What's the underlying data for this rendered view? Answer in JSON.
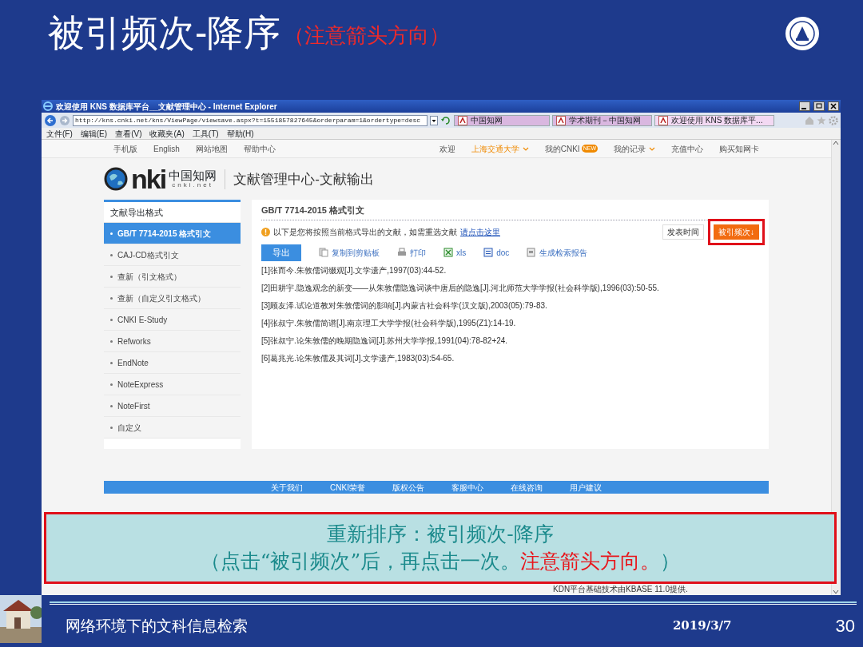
{
  "slide": {
    "title": "被引频次-降序",
    "title_note": "（注意箭头方向）"
  },
  "browser": {
    "title": "欢迎使用 KNS 数据库平台__文献管理中心 - Internet Explorer",
    "address": "http://kns.cnki.net/kns/ViewPage/viewsave.aspx?t=1551857827645&orderparam=1&ordertype=desc",
    "tabs": [
      {
        "label": "中国知网",
        "selected": false
      },
      {
        "label": "学术期刊－中国知网",
        "selected": false
      },
      {
        "label": "欢迎使用 KNS 数据库平...",
        "selected": true
      }
    ],
    "menu": [
      "文件(F)",
      "编辑(E)",
      "查看(V)",
      "收藏夹(A)",
      "工具(T)",
      "帮助(H)"
    ]
  },
  "site": {
    "top_links": [
      "手机版",
      "English",
      "网站地图",
      "帮助中心"
    ],
    "user_links": [
      {
        "label": "欢迎",
        "kind": "plain"
      },
      {
        "label": "上海交通大学",
        "kind": "highlight"
      },
      {
        "label": "我的CNKI",
        "kind": "badge",
        "badge": "NEW"
      },
      {
        "label": "我的记录",
        "kind": "dropdown"
      },
      {
        "label": "充值中心",
        "kind": "plain"
      },
      {
        "label": "购买知网卡",
        "kind": "plain"
      }
    ],
    "logo": {
      "mark": "nki",
      "name": "中国知网",
      "domain": "cnki.net"
    },
    "page_title": "文献管理中心-文献输出",
    "sidebar": {
      "heading": "文献导出格式",
      "items": [
        {
          "label": "GB/T 7714-2015 格式引文",
          "selected": true
        },
        {
          "label": "CAJ-CD格式引文",
          "selected": false
        },
        {
          "label": "查新（引文格式）",
          "selected": false
        },
        {
          "label": "查新（自定义引文格式）",
          "selected": false
        },
        {
          "label": "CNKI E-Study",
          "selected": false
        },
        {
          "label": "Refworks",
          "selected": false
        },
        {
          "label": "EndNote",
          "selected": false
        },
        {
          "label": "NoteExpress",
          "selected": false
        },
        {
          "label": "NoteFirst",
          "selected": false
        },
        {
          "label": "自定义",
          "selected": false
        }
      ]
    },
    "content": {
      "heading": "GB/T 7714-2015 格式引文",
      "notice": "以下是您将按照当前格式导出的文献，如需重选文献",
      "notice_link": "请点击这里",
      "sort": {
        "highlighted": true,
        "buttons": [
          {
            "label": "发表时间",
            "selected": false
          },
          {
            "label": "被引频次↓",
            "selected": true
          }
        ]
      },
      "export_button": "导出",
      "tools": [
        {
          "label": "复制到剪贴板",
          "kind": "copy"
        },
        {
          "label": "打印",
          "kind": "print"
        },
        {
          "label": "xls",
          "kind": "xls"
        },
        {
          "label": "doc",
          "kind": "doc"
        },
        {
          "label": "生成检索报告",
          "kind": "report"
        }
      ],
      "references": [
        "[1]张而今.朱敦儒词缀观[J].文学遗产,1997(03):44-52.",
        "[2]田耕宇.隐逸观念的新变——从朱敦儒隐逸词谈中唐后的隐逸[J].河北师范大学学报(社会科学版),1996(03):50-55.",
        "[3]顾友泽.试论道教对朱敦儒词的影响[J].内蒙古社会科学(汉文版),2003(05):79-83.",
        "[4]张叔宁.朱敦儒简谱[J].南京理工大学学报(社会科学版),1995(Z1):14-19.",
        "[5]张叔宁.论朱敦儒的晚期隐逸词[J].苏州大学学报,1991(04):78-82+24.",
        "[6]葛兆光.论朱敦儒及其词[J].文学遗产,1983(03):54-65."
      ]
    },
    "footer_links": [
      "关于我们",
      "CNKI荣誉",
      "版权公告",
      "客服中心",
      "在线咨询",
      "用户建议"
    ],
    "credit": "KDN平台基础技术由KBASE 11.0提供."
  },
  "callout": {
    "line1": "重新排序：被引频次-降序",
    "line2": [
      {
        "text": "（点击“被引频次”后，再点击一次。",
        "emphasis": false
      },
      {
        "text": "注意箭头方向。",
        "emphasis": true
      },
      {
        "text": "）",
        "emphasis": false
      }
    ]
  },
  "footer": {
    "course": "网络环境下的文科信息检索",
    "date": "2019/3/7",
    "page": "30"
  }
}
